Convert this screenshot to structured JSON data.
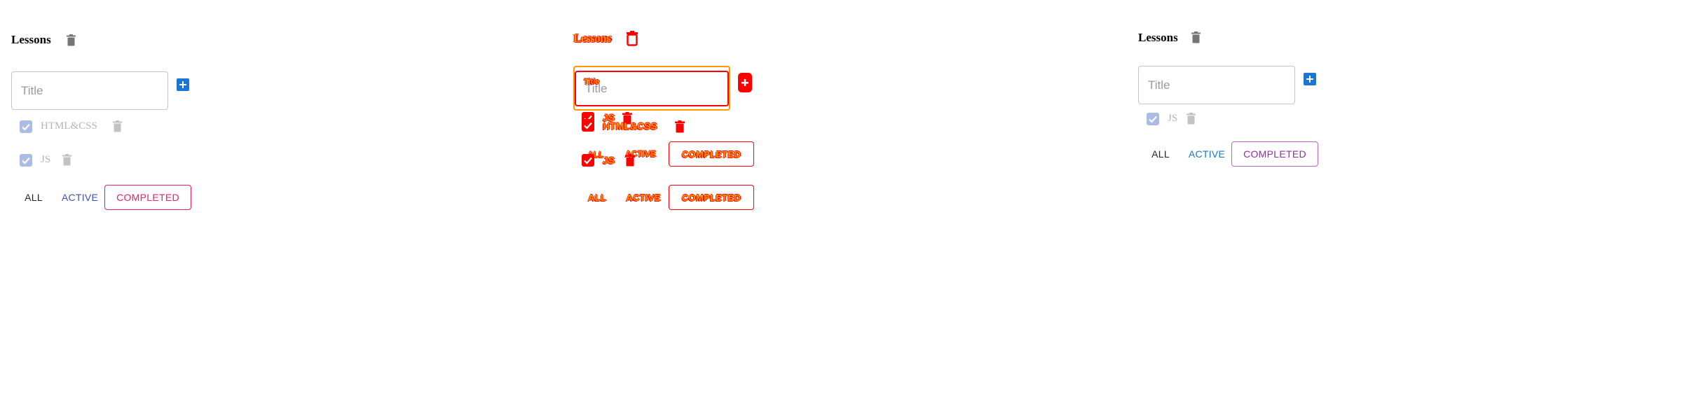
{
  "left": {
    "title": "Lessons",
    "input": {
      "placeholder": "Title",
      "value": ""
    },
    "items": [
      {
        "label": "HTML&CSS",
        "checked": true
      },
      {
        "label": "JS",
        "checked": true
      }
    ],
    "filters": {
      "all": "ALL",
      "active": "ACTIVE",
      "completed": "COMPLETED"
    }
  },
  "middle": {
    "title": "Lessons",
    "input": {
      "placeholder": "Title",
      "value": ""
    },
    "items": [
      {
        "label": "JS",
        "checked": true
      },
      {
        "label": "HTML&CSS",
        "checked": true
      },
      {
        "label": "JS",
        "checked": true
      }
    ],
    "filters_top": {
      "all": "ALL",
      "active": "ACTIVE",
      "completed": "COMPLETED"
    },
    "filters": {
      "all": "ALL",
      "active": "ACTIVE",
      "completed": "COMPLETED"
    }
  },
  "right": {
    "title": "Lessons",
    "input": {
      "placeholder": "Title",
      "value": ""
    },
    "items": [
      {
        "label": "JS",
        "checked": true
      }
    ],
    "filters": {
      "all": "ALL",
      "active": "ACTIVE",
      "completed": "COMPLETED"
    }
  },
  "colors": {
    "primary": "#1976d2",
    "disabled_check": "#a9bde4",
    "disabled_text": "#b5b5b5",
    "left_completed": "#e91e63",
    "right_completed": "#9c27b0",
    "glitch_red": "#ff0000",
    "glitch_orange": "#ff9800"
  },
  "icons": [
    "trash-icon",
    "plus-icon",
    "checkbox-checked-icon"
  ]
}
